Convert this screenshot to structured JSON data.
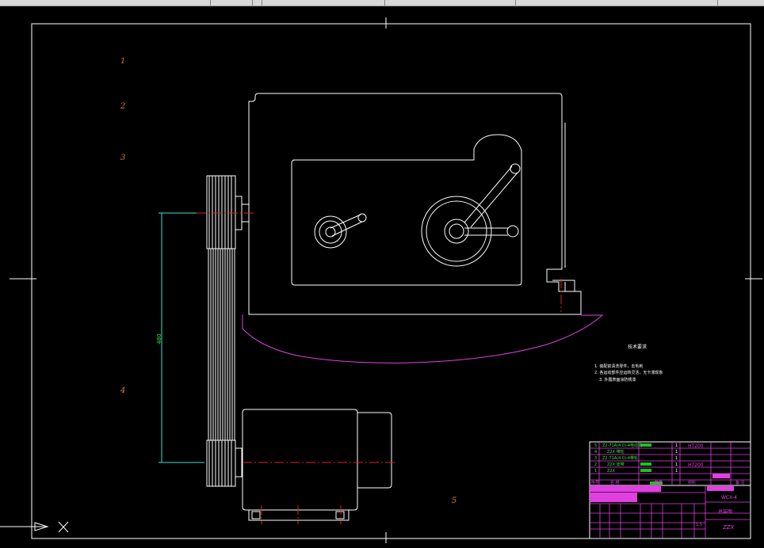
{
  "drawing": {
    "balloons": [
      "1",
      "2",
      "3",
      "4",
      "5"
    ],
    "dimension": "480",
    "tech_title": "技术要求",
    "tech_items": [
      "1. 装配前清洗零件，去毛刺",
      "2. 各运动部件应运转灵活，无卡滞现象",
      "3. 外露表面涂防锈漆"
    ]
  },
  "title_block": {
    "rows": [
      {
        "no": "5",
        "name": "Z2-71A(4.0)-4电动机",
        "qty": "1",
        "mat": "HT200"
      },
      {
        "no": "4",
        "name": "Z2X 带轮",
        "qty": "1",
        "mat": ""
      },
      {
        "no": "3",
        "name": "Z2-71A(4.0)-4带轮",
        "qty": "1",
        "mat": "HT200"
      },
      {
        "no": "2",
        "name": "Z2X 皮带",
        "qty": "1",
        "mat": ""
      },
      {
        "no": "1",
        "name": "Z2X",
        "qty": "1",
        "mat": ""
      }
    ],
    "headers": [
      "序号",
      "名 称",
      "数量",
      "材料",
      "备 注"
    ],
    "drawing_no": "WCX-4",
    "assembly": "总装图",
    "school": "ZZX",
    "scale": "1:5"
  }
}
